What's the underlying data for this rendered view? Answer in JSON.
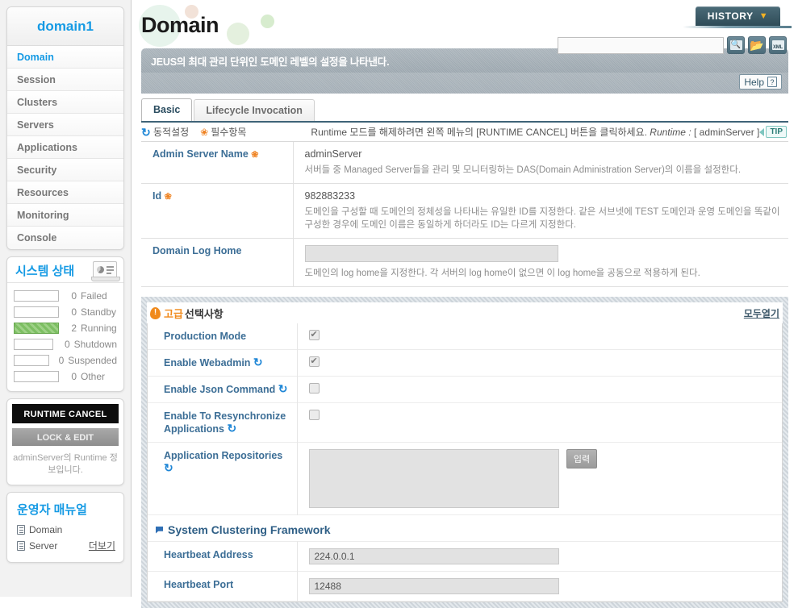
{
  "sidebar": {
    "domain_title": "domain1",
    "nav": [
      {
        "label": "Domain",
        "active": true
      },
      {
        "label": "Session",
        "active": false
      },
      {
        "label": "Clusters",
        "active": false
      },
      {
        "label": "Servers",
        "active": false
      },
      {
        "label": "Applications",
        "active": false
      },
      {
        "label": "Security",
        "active": false
      },
      {
        "label": "Resources",
        "active": false
      },
      {
        "label": "Monitoring",
        "active": false
      },
      {
        "label": "Console",
        "active": false
      }
    ],
    "status": {
      "title": "시스템 상태",
      "icon": "monitor-chart-icon",
      "rows": [
        {
          "count": "0",
          "label": "Failed",
          "filled": false
        },
        {
          "count": "0",
          "label": "Standby",
          "filled": false
        },
        {
          "count": "2",
          "label": "Running",
          "filled": true
        },
        {
          "count": "0",
          "label": "Shutdown",
          "filled": false
        },
        {
          "count": "0",
          "label": "Suspended",
          "filled": false
        },
        {
          "count": "0",
          "label": "Other",
          "filled": false
        }
      ],
      "fill_color": "#7dbf63"
    },
    "runtime_cancel_label": "RUNTIME CANCEL",
    "lock_edit_label": "LOCK & EDIT",
    "runtime_note": "adminServer의 Runtime 정보입니다.",
    "manual": {
      "title": "운영자 매뉴얼",
      "items": [
        "Domain",
        "Server"
      ],
      "more_label": "더보기"
    }
  },
  "header": {
    "page_title": "Domain",
    "history_label": "HISTORY",
    "history_caret": "▼",
    "search_placeholder": "",
    "search_value": "",
    "icons": [
      "search-icon",
      "sync-folder-icon",
      "xml-export-icon"
    ],
    "help_label": "Help",
    "help_mark": "?"
  },
  "banner": {
    "text": "JEUS의 최대 관리 단위인 도메인 레벨의 설정을 나타낸다."
  },
  "tabs": [
    {
      "label": "Basic",
      "active": true
    },
    {
      "label": "Lifecycle Invocation",
      "active": false
    }
  ],
  "legend": {
    "dynamic_label": "동적설정",
    "required_label": "필수항목",
    "note_prefix": "Runtime 모드를 해제하려면 왼쪽 메뉴의 [RUNTIME CANCEL] 버튼을 클릭하세요.",
    "note_runtime_key": "Runtime :",
    "note_runtime_value": "[ adminServer ]",
    "tip_label": "TIP"
  },
  "basic_rows": [
    {
      "label": "Admin Server Name",
      "required": true,
      "value": "adminServer",
      "desc": "서버들 중 Managed Server들을 관리 및 모니터링하는 DAS(Domain Administration Server)의 이름을 설정한다.",
      "type": "text"
    },
    {
      "label": "Id",
      "required": true,
      "value": "982883233",
      "desc": "도메인을 구성할 때 도메인의 정체성을 나타내는 유일한 ID를 지정한다. 같은 서브넷에 TEST 도메인과 운영 도메인을 똑같이 구성한 경우에 도메인 이름은 동일하게 하더라도 ID는 다르게 지정한다.",
      "type": "text"
    },
    {
      "label": "Domain Log Home",
      "required": false,
      "value": "",
      "desc": "도메인의 log home을 지정한다. 각 서버의 log home이 없으면 이 log home을 공동으로 적용하게 된다.",
      "type": "input"
    }
  ],
  "advanced": {
    "title_accent": "고급",
    "title_rest": "선택사항",
    "open_all_label": "모두열기",
    "rows": [
      {
        "label": "Production Mode",
        "sync": false,
        "type": "checkbox",
        "checked": true
      },
      {
        "label": "Enable Webadmin",
        "sync": true,
        "type": "checkbox",
        "checked": true
      },
      {
        "label": "Enable Json Command",
        "sync": true,
        "type": "checkbox",
        "checked": false
      },
      {
        "label": "Enable To Resynchronize Applications",
        "sync": true,
        "type": "checkbox",
        "checked": false
      },
      {
        "label": "Application Repositories",
        "sync": true,
        "type": "textarea",
        "value": "",
        "button_label": "입력"
      }
    ],
    "subsection": {
      "title": "System Clustering Framework",
      "rows": [
        {
          "label": "Heartbeat Address",
          "value": "224.0.0.1"
        },
        {
          "label": "Heartbeat Port",
          "value": "12488"
        }
      ]
    }
  },
  "colors": {
    "accent_blue": "#159ae4",
    "label_blue": "#3c6e96",
    "required_orange": "#ef8424",
    "history_dark": "#2f4c58",
    "running_green": "#7dbf63"
  }
}
